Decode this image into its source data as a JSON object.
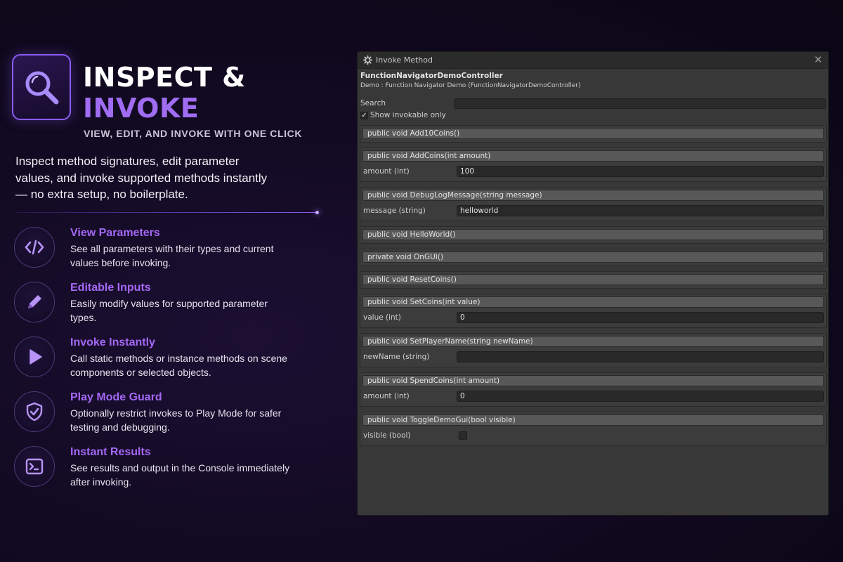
{
  "brand": {
    "title_line1": "INSPECT &",
    "title_line2": "INVOKE",
    "tagline": "VIEW, EDIT, AND INVOKE WITH ONE CLICK",
    "intro": "Inspect method signatures, edit parameter values, and invoke supported methods instantly — no extra setup, no boilerplate.",
    "accent_color": "#a06cf2",
    "logo_icon": "magnifier-icon"
  },
  "features": [
    {
      "icon": "code-icon",
      "title": "View Parameters",
      "desc": "See all parameters with their types and current values before invoking."
    },
    {
      "icon": "pencil-icon",
      "title": "Editable Inputs",
      "desc": "Easily modify values for supported parameter types."
    },
    {
      "icon": "play-icon",
      "title": "Invoke Instantly",
      "desc": "Call static methods or instance methods on scene components or selected objects."
    },
    {
      "icon": "shield-check-icon",
      "title": "Play Mode Guard",
      "desc": "Optionally restrict invokes to Play Mode for safer testing and debugging."
    },
    {
      "icon": "console-icon",
      "title": "Instant Results",
      "desc": "See results and output in the Console immediately after invoking."
    }
  ],
  "window": {
    "title": "Invoke Method",
    "close_glyph": "✕",
    "target_name": "FunctionNavigatorDemoController",
    "target_path": "Demo : Function Navigator Demo (FunctionNavigatorDemoController)",
    "search_label": "Search",
    "search_value": "",
    "show_invokable_label": "Show invokable only",
    "show_invokable_checked": true,
    "methods": [
      {
        "signature": "public void Add10Coins()",
        "params": []
      },
      {
        "signature": "public void AddCoins(int amount)",
        "params": [
          {
            "label": "amount (int)",
            "type": "text",
            "value": "100"
          }
        ]
      },
      {
        "signature": "public void DebugLogMessage(string message)",
        "params": [
          {
            "label": "message (string)",
            "type": "text",
            "value": "helloworld"
          }
        ]
      },
      {
        "signature": "public void HelloWorld()",
        "params": []
      },
      {
        "signature": "private void OnGUI()",
        "params": []
      },
      {
        "signature": "public void ResetCoins()",
        "params": []
      },
      {
        "signature": "public void SetCoins(int value)",
        "params": [
          {
            "label": "value (int)",
            "type": "text",
            "value": "0"
          }
        ]
      },
      {
        "signature": "public void SetPlayerName(string newName)",
        "params": [
          {
            "label": "newName (string)",
            "type": "text",
            "value": ""
          }
        ]
      },
      {
        "signature": "public void SpendCoins(int amount)",
        "params": [
          {
            "label": "amount (int)",
            "type": "text",
            "value": "0"
          }
        ]
      },
      {
        "signature": "public void ToggleDemoGui(bool visible)",
        "params": [
          {
            "label": "visible (bool)",
            "type": "bool",
            "value": false
          }
        ]
      }
    ]
  }
}
